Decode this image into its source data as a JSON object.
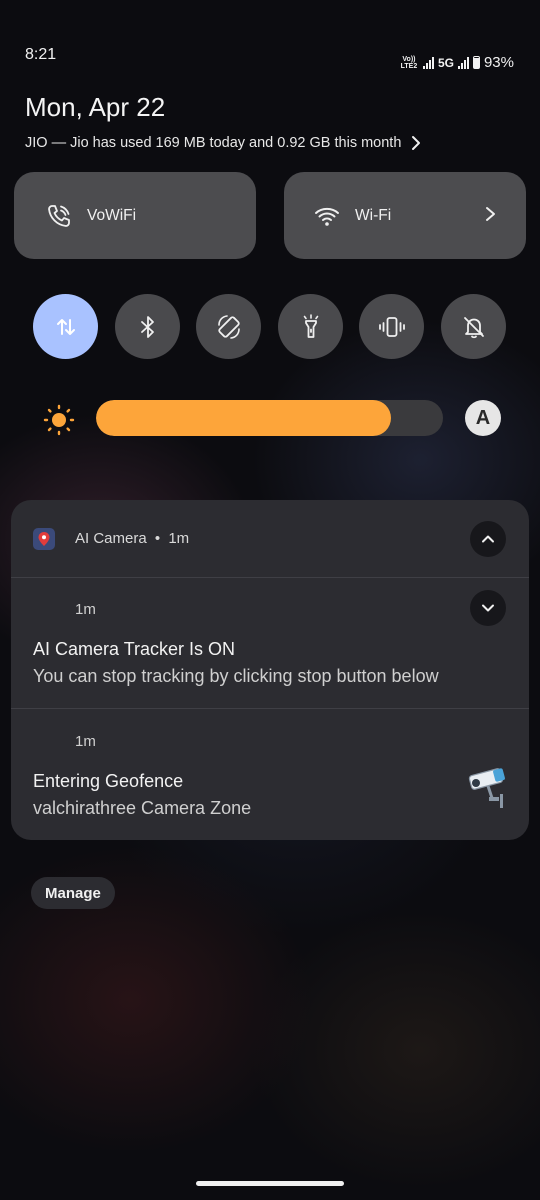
{
  "status_bar": {
    "time": "8:21",
    "volte_line1": "Vo))",
    "volte_line2": "LTE2",
    "network": "5G",
    "battery": "93%"
  },
  "date": "Mon, Apr 22",
  "carrier_text": "JIO — Jio has used 169 MB today and 0.92 GB this month",
  "tiles": {
    "vowifi": "VoWiFi",
    "wifi": "Wi-Fi"
  },
  "toggles": [
    "mobile-data",
    "bluetooth",
    "auto-rotate",
    "flashlight",
    "vibrate",
    "do-not-disturb"
  ],
  "brightness": {
    "level": 0.85,
    "auto_label": "A",
    "fill_color": "#fda53a"
  },
  "notification": {
    "app_name": "AI Camera",
    "separator": "•",
    "app_time": "1m",
    "items": [
      {
        "time": "1m",
        "title": "AI Camera Tracker Is ON",
        "body": "You can stop tracking by clicking stop button below"
      },
      {
        "time": "1m",
        "title": "Entering Geofence",
        "body": "valchirathree Camera Zone"
      }
    ]
  },
  "manage_label": "Manage",
  "colors": {
    "accent": "#a9c2ff",
    "tile_bg": "#4c4c4f",
    "card_bg": "#2c2c31"
  }
}
